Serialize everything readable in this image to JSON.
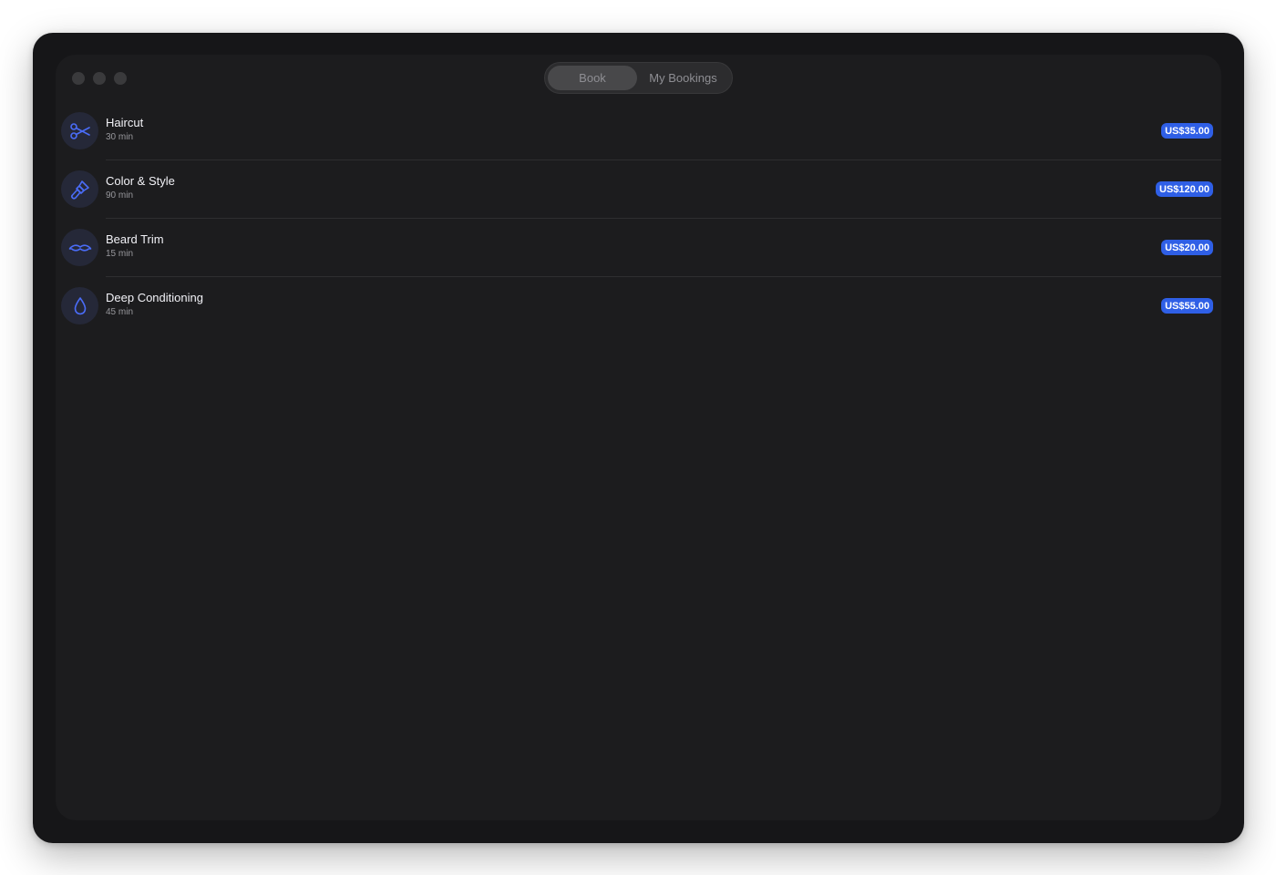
{
  "window": {
    "tabs": [
      {
        "label": "Book",
        "active": true
      },
      {
        "label": "My Bookings",
        "active": false
      }
    ]
  },
  "services": [
    {
      "name": "Haircut",
      "duration": "30 min",
      "price": "US$35.00",
      "icon": "scissors-icon"
    },
    {
      "name": "Color & Style",
      "duration": "90 min",
      "price": "US$120.00",
      "icon": "paintbrush-icon"
    },
    {
      "name": "Beard Trim",
      "duration": "15 min",
      "price": "US$20.00",
      "icon": "mustache-icon"
    },
    {
      "name": "Deep Conditioning",
      "duration": "45 min",
      "price": "US$55.00",
      "icon": "drop-icon"
    }
  ],
  "colors": {
    "accent": "#2f5fe6",
    "icon_stroke": "#4a6cf7",
    "window_bg": "#1c1c1e",
    "frame_bg": "#161618"
  }
}
